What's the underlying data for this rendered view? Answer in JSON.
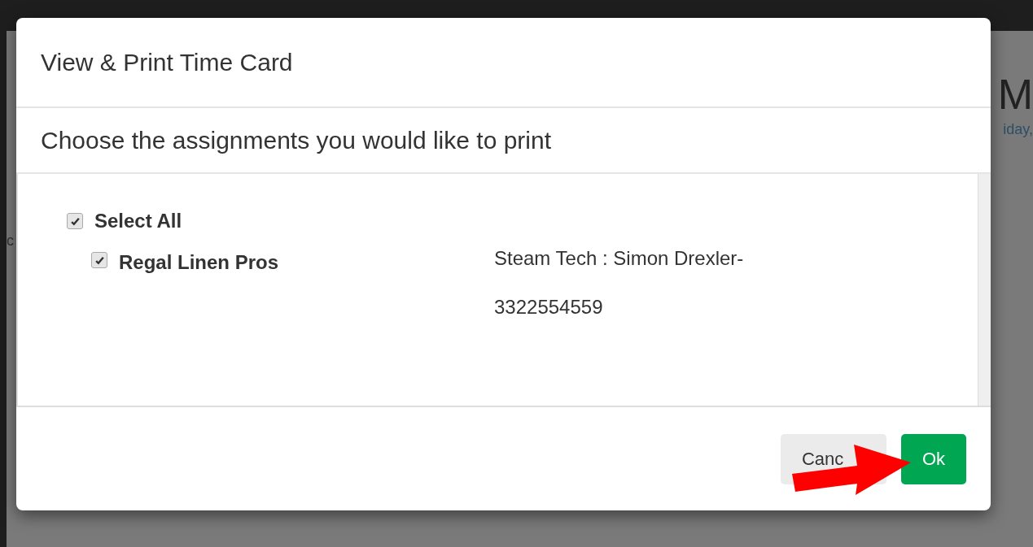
{
  "background": {
    "heading": "M",
    "subheading": "iday,",
    "side_text": "c"
  },
  "dialog": {
    "title": "View & Print Time Card",
    "prompt": "Choose the assignments you would like to print",
    "select_all": {
      "label": "Select All",
      "checked": true
    },
    "assignments": [
      {
        "name": "Regal Linen Pros",
        "checked": true,
        "detail": "Steam Tech : Simon Drexler-3322554559"
      }
    ],
    "buttons": [
      {
        "kind": "secondary",
        "label": "Canc"
      },
      {
        "kind": "primary",
        "label": "Ok"
      }
    ]
  },
  "annotation": {
    "kind": "arrow"
  }
}
